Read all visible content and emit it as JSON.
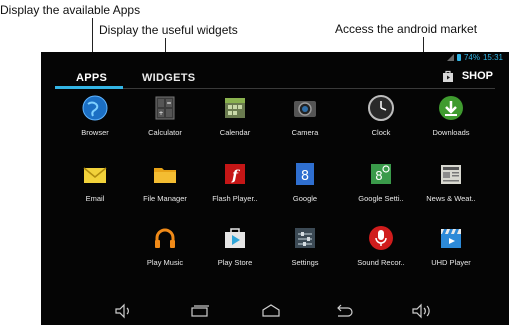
{
  "callouts": {
    "apps": "Display the available Apps",
    "widgets": "Display the useful widgets",
    "market": "Access the android market"
  },
  "status": {
    "battery": "74%",
    "time": "15:31"
  },
  "tabs": {
    "apps": "APPS",
    "widgets": "WIDGETS",
    "shop": "SHOP"
  },
  "apps": [
    {
      "label": "Browser",
      "icon": "globe-icon"
    },
    {
      "label": "Calculator",
      "icon": "calculator-icon"
    },
    {
      "label": "Calendar",
      "icon": "calendar-icon"
    },
    {
      "label": "Camera",
      "icon": "camera-icon"
    },
    {
      "label": "Clock",
      "icon": "clock-icon"
    },
    {
      "label": "Downloads",
      "icon": "download-icon"
    },
    {
      "label": "Email",
      "icon": "email-icon"
    },
    {
      "label": "File Manager",
      "icon": "folder-icon"
    },
    {
      "label": "Flash Player..",
      "icon": "flash-icon"
    },
    {
      "label": "Google",
      "icon": "google-icon"
    },
    {
      "label": "Google Setti..",
      "icon": "google-settings-icon"
    },
    {
      "label": "News & Weat..",
      "icon": "newspaper-icon"
    },
    {
      "label": "Play Music",
      "icon": "headphones-icon"
    },
    {
      "label": "Play Store",
      "icon": "play-store-icon"
    },
    {
      "label": "Settings",
      "icon": "settings-icon"
    },
    {
      "label": "Sound Recor..",
      "icon": "microphone-icon"
    },
    {
      "label": "UHD Player",
      "icon": "clapperboard-icon"
    }
  ],
  "colors": {
    "accent": "#33b5e5",
    "background": "#050505"
  }
}
